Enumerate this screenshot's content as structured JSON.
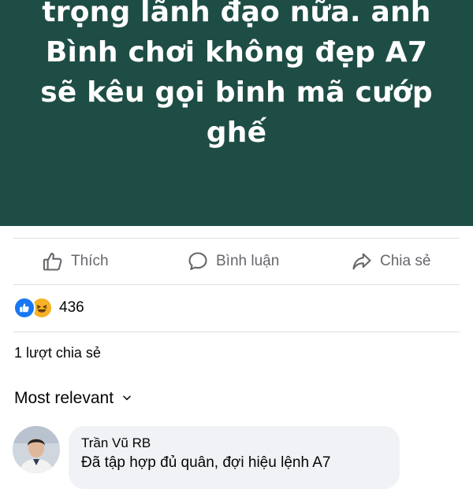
{
  "post": {
    "banner_lines": [
      "trọng lãnh đạo nữa. anh",
      "Bình chơi không đẹp A7",
      "sẽ kêu gọi binh mã cướp",
      "ghế"
    ],
    "banner_color": "#1e4d45"
  },
  "actions": {
    "like_label": "Thích",
    "comment_label": "Bình luận",
    "share_label": "Chia sẻ"
  },
  "reactions": {
    "count": "436",
    "types": [
      "like-icon",
      "haha-icon"
    ]
  },
  "shares": {
    "label": "1 lượt chia sẻ"
  },
  "comments": {
    "sort_label": "Most relevant",
    "items": [
      {
        "author": "Trần Vũ RB",
        "text": "Đã tập hợp đủ quân, đợi hiệu lệnh A7"
      }
    ]
  }
}
